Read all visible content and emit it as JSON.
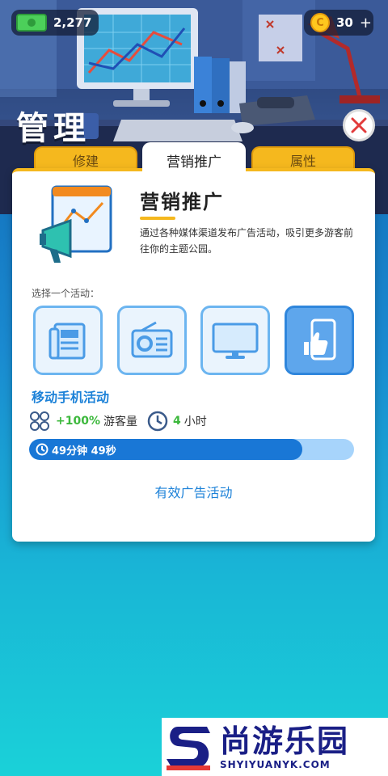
{
  "header": {
    "title": "管理",
    "money": "2,277",
    "coins": "30",
    "coin_symbol": "C",
    "add_symbol": "+"
  },
  "tabs": [
    {
      "label": "修建",
      "active": false
    },
    {
      "label": "营销推广",
      "active": true
    },
    {
      "label": "属性",
      "active": false
    }
  ],
  "panel": {
    "title": "营销推广",
    "description": "通过各种媒体渠道发布广告活动，吸引更多游客前往你的主题公园。",
    "choose_label": "选择一个活动：",
    "options": [
      {
        "icon": "newspaper-icon",
        "selected": false
      },
      {
        "icon": "radio-icon",
        "selected": false
      },
      {
        "icon": "tv-icon",
        "selected": false
      },
      {
        "icon": "mobile-thumbs-up-icon",
        "selected": true
      }
    ],
    "activity_name": "移动手机活动",
    "visitor_boost": "+100%",
    "visitor_label": "游客量",
    "duration_value": "4",
    "duration_unit": "小时",
    "progress": {
      "fraction": 0.84,
      "text": "49分钟 49秒"
    },
    "active_link": "有效广告活动"
  },
  "watermark": {
    "cn": "尚游乐园",
    "en": "SHYIYUANYK.COM"
  },
  "colors": {
    "accent_blue": "#1d82d8",
    "tab_yellow": "#f5b81e",
    "progress_fill": "#1977d6",
    "progress_track": "#a7d4fb",
    "positive_green": "#3cb83c"
  }
}
